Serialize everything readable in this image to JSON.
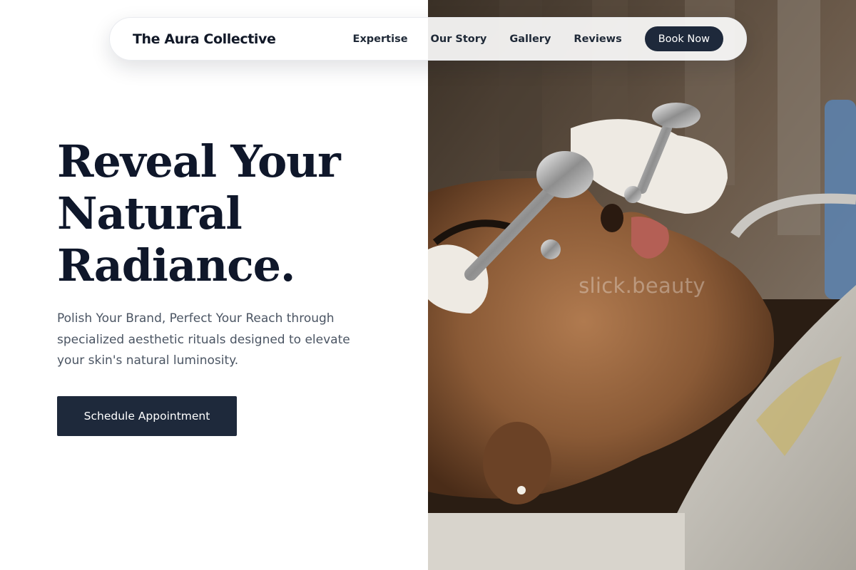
{
  "brand": {
    "name": "The Aura Collective"
  },
  "nav": {
    "links": [
      {
        "label": "Expertise"
      },
      {
        "label": "Our Story"
      },
      {
        "label": "Gallery"
      },
      {
        "label": "Reviews"
      }
    ],
    "book_label": "Book Now"
  },
  "hero": {
    "headline_lines": [
      "Reveal Your",
      "Natural",
      "Radiance."
    ],
    "subtext": "Polish Your Brand, Perfect Your Reach through specialized aesthetic rituals designed to elevate your skin's natural luminosity.",
    "cta_label": "Schedule Appointment",
    "image_watermark": "slick.beauty"
  },
  "colors": {
    "accent_navy": "#1e293b",
    "heading": "#0f172a",
    "body_text": "#4b5563",
    "background": "#ffffff"
  }
}
